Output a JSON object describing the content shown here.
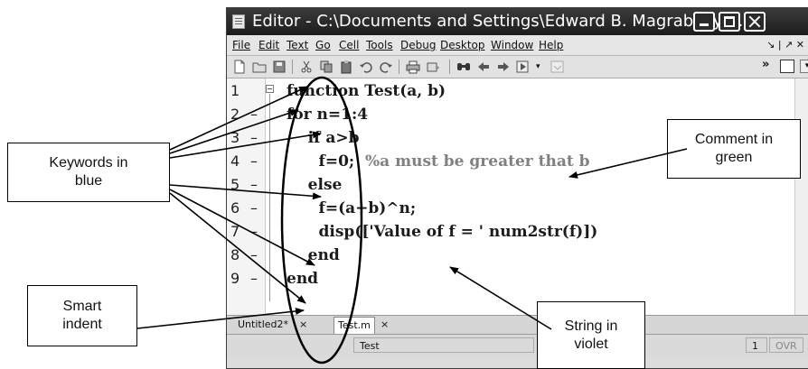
{
  "window": {
    "title": "Editor - C:\\Documents and Settings\\Edward B. Magrab\\My ..."
  },
  "menu": {
    "items": [
      "File",
      "Edit",
      "Text",
      "Go",
      "Cell",
      "Tools",
      "Debug",
      "Desktop",
      "Window",
      "Help"
    ],
    "dock_controls": "↘ | ↗ ✕"
  },
  "toolbar": {
    "icons": [
      "new-file-icon",
      "open-file-icon",
      "save-icon",
      "cut-icon",
      "copy-icon",
      "paste-icon",
      "undo-icon",
      "redo-icon",
      "print-icon",
      "tools-icon",
      "find-icon",
      "back-icon",
      "forward-icon",
      "run-icon"
    ],
    "more": "»"
  },
  "editor": {
    "line_numbers": [
      "1",
      "2",
      "3",
      "4",
      "5",
      "6",
      "7",
      "8",
      "9"
    ],
    "line_markers": [
      "",
      "–",
      "–",
      "–",
      "–",
      "–",
      "–",
      "–",
      "–"
    ],
    "lines": [
      {
        "code": "function Test(a, b)",
        "comment": ""
      },
      {
        "code": "for n=1:4",
        "comment": ""
      },
      {
        "code": "    if a>b",
        "comment": ""
      },
      {
        "code": "      f=0;  ",
        "comment": "%a must be greater that b"
      },
      {
        "code": "    else",
        "comment": ""
      },
      {
        "code": "      f=(a+b)^n;",
        "comment": ""
      },
      {
        "code": "      disp(['Value of f = ' num2str(f)])",
        "comment": ""
      },
      {
        "code": "    end",
        "comment": ""
      },
      {
        "code": "end",
        "comment": ""
      }
    ]
  },
  "tabs": [
    {
      "label": "Untitled2*",
      "close": "×"
    },
    {
      "label": "Test.m",
      "close": "×"
    }
  ],
  "status": {
    "function_name": "Test",
    "column": "1",
    "mode": "OVR"
  },
  "annotations": {
    "keywords": [
      "Keywords in",
      "blue"
    ],
    "comment": [
      "Comment in",
      "green"
    ],
    "smart_indent": [
      "Smart",
      "indent"
    ],
    "string": [
      "String in",
      "violet"
    ]
  },
  "colors": {
    "comment_rendered": "#808080",
    "code_rendered": "#1b1b1b"
  }
}
